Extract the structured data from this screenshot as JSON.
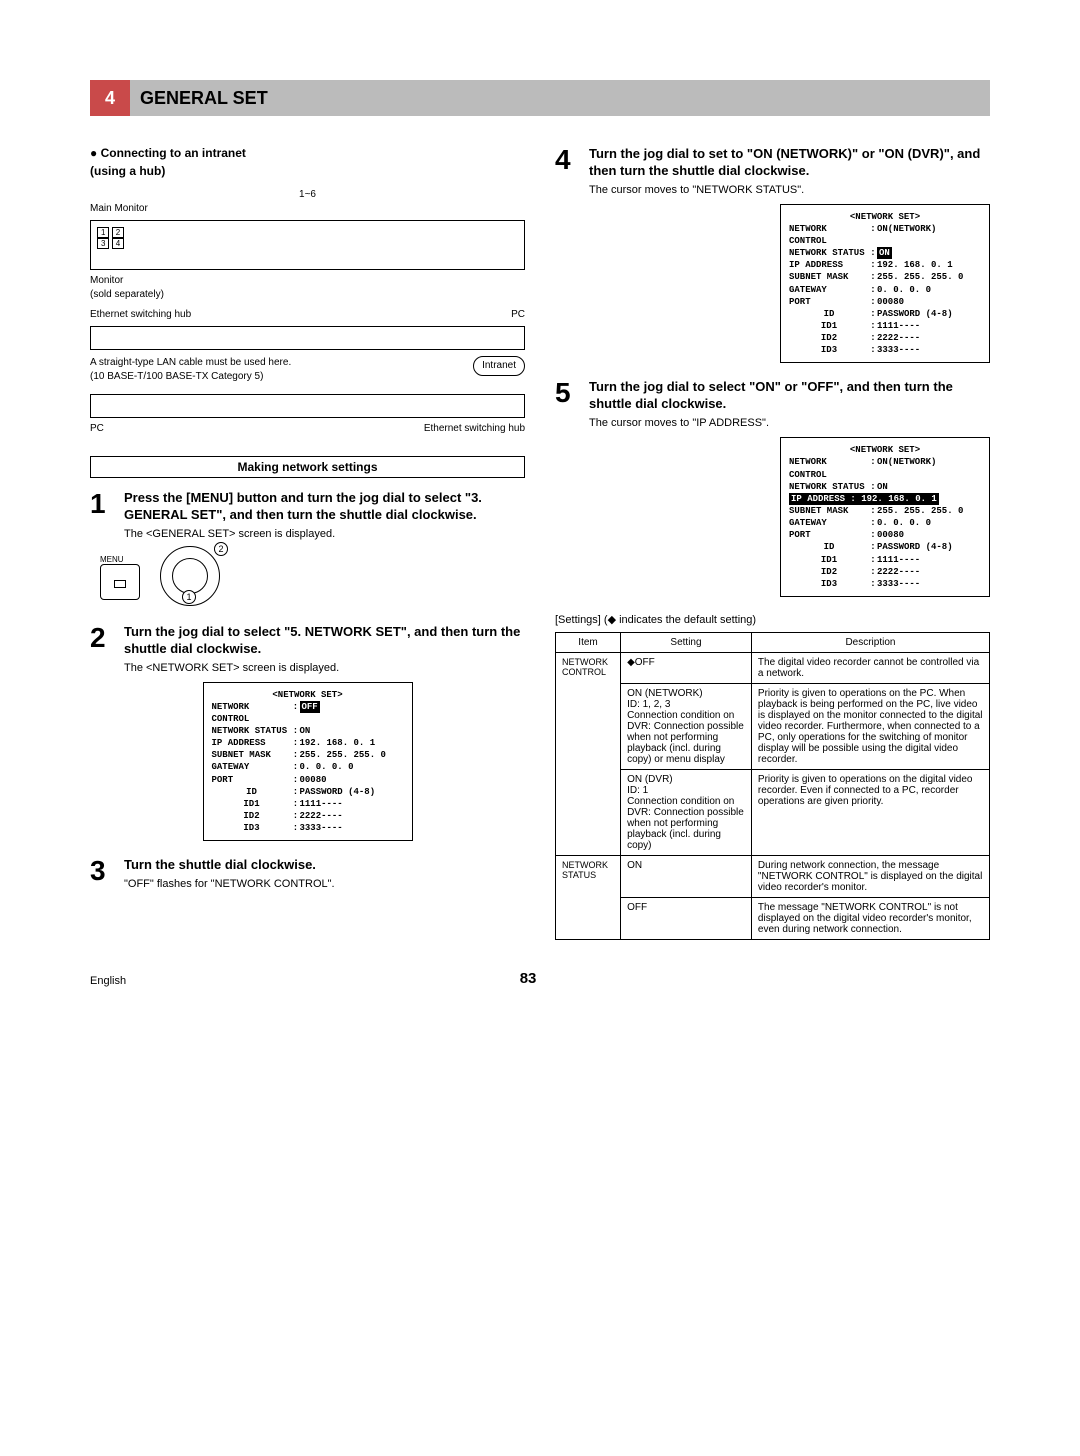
{
  "header": {
    "num": "4",
    "title": "GENERAL SET"
  },
  "left": {
    "connect_head": "● Connecting to an intranet",
    "connect_sub": "(using a hub)",
    "diag": {
      "range": "1~6",
      "main_monitor": "Main Monitor",
      "monitor": "Monitor",
      "sold_sep": "(sold separately)",
      "hub1": "Ethernet switching hub",
      "pc1": "PC",
      "cable_note1": "A straight-type LAN cable must be used here.",
      "cable_note2": "(10 BASE-T/100 BASE-TX Category 5)",
      "intranet": "Intranet",
      "pc2": "PC",
      "hub2": "Ethernet switching hub"
    },
    "making_settings": "Making network settings",
    "step1": {
      "num": "1",
      "title": "Press the [MENU] button and turn the jog dial to select \"3. GENERAL SET\", and then turn the shuttle dial clockwise.",
      "desc": "The <GENERAL SET> screen is displayed.",
      "menu": "MENU",
      "c1": "1",
      "c2": "2"
    },
    "step2": {
      "num": "2",
      "title": "Turn the jog dial to select \"5. NETWORK SET\", and then turn the shuttle dial clockwise.",
      "desc": "The <NETWORK SET> screen is displayed."
    },
    "osd2": {
      "title": "<NETWORK SET>",
      "ctrl_k": "NETWORK CONTROL",
      "ctrl_v": "OFF",
      "status_k": "NETWORK STATUS",
      "status_v": "ON",
      "ip_k": "IP ADDRESS",
      "ip_v": "192. 168.   0.   1",
      "subnet_k": "SUBNET MASK",
      "subnet_v": "255. 255. 255.   0",
      "gw_k": "GATEWAY",
      "gw_v": "  0.   0.   0.   0",
      "port_k": "PORT",
      "port_v": "00080",
      "id_k": "ID",
      "id_v": "PASSWORD (4-8)",
      "id1_k": "ID1",
      "id1_v": "1111----",
      "id2_k": "ID2",
      "id2_v": "2222----",
      "id3_k": "ID3",
      "id3_v": "3333----"
    },
    "step3": {
      "num": "3",
      "title": "Turn the shuttle dial clockwise.",
      "desc": "\"OFF\" flashes for \"NETWORK CONTROL\"."
    }
  },
  "right": {
    "step4": {
      "num": "4",
      "title": "Turn the jog dial to set to \"ON (NETWORK)\" or \"ON (DVR)\", and then turn the shuttle dial clockwise.",
      "desc": "The cursor moves to \"NETWORK STATUS\"."
    },
    "osd4": {
      "title": "<NETWORK SET>",
      "ctrl_k": "NETWORK CONTROL",
      "ctrl_v": "ON(NETWORK)",
      "status_k": "NETWORK STATUS",
      "status_v": "ON",
      "ip_k": "IP ADDRESS",
      "ip_v": "192. 168.   0.   1",
      "subnet_k": "SUBNET MASK",
      "subnet_v": "255. 255. 255.   0",
      "gw_k": "GATEWAY",
      "gw_v": "  0.   0.   0.   0",
      "port_k": "PORT",
      "port_v": "00080",
      "id_k": "ID",
      "id_v": "PASSWORD (4-8)",
      "id1_k": "ID1",
      "id1_v": "1111----",
      "id2_k": "ID2",
      "id2_v": "2222----",
      "id3_k": "ID3",
      "id3_v": "3333----"
    },
    "step5": {
      "num": "5",
      "title": "Turn the jog dial to select \"ON\" or \"OFF\", and then turn the shuttle dial clockwise.",
      "desc": "The cursor moves to \"IP ADDRESS\"."
    },
    "osd5": {
      "title": "<NETWORK SET>",
      "ctrl_k": "NETWORK CONTROL",
      "ctrl_v": "ON(NETWORK)",
      "status_k": "NETWORK STATUS",
      "status_v": "ON",
      "ip_k": "IP ADDRESS",
      "ip_v": "192. 168.   0.   1",
      "subnet_k": "SUBNET MASK",
      "subnet_v": "255. 255. 255.   0",
      "gw_k": "GATEWAY",
      "gw_v": "  0.   0.   0.   0",
      "port_k": "PORT",
      "port_v": "00080",
      "id_k": "ID",
      "id_v": "PASSWORD (4-8)",
      "id1_k": "ID1",
      "id1_v": "1111----",
      "id2_k": "ID2",
      "id2_v": "2222----",
      "id3_k": "ID3",
      "id3_v": "3333----"
    },
    "settings_note": "[Settings] (◆ indicates the default setting)",
    "table": {
      "h1": "Item",
      "h2": "Setting",
      "h3": "Description",
      "r1_item": "NETWORK CONTROL",
      "r1a_set": "◆OFF",
      "r1a_desc": "The digital video recorder cannot be controlled via a network.",
      "r1b_set": "ON (NETWORK)\nID: 1, 2, 3\nConnection condition on DVR: Connection possible when not performing playback (incl. during copy) or menu display",
      "r1b_desc": "Priority is given to operations on the PC. When playback is being performed on the PC, live video is displayed on the monitor connected to the digital video recorder. Furthermore, when connected to a PC, only operations for the switching of monitor display will be possible using the digital video recorder.",
      "r1c_set": "ON (DVR)\nID: 1\nConnection condition on DVR: Connection possible when not performing playback (incl. during copy)",
      "r1c_desc": "Priority is given to operations on the digital video recorder. Even if connected to a PC, recorder operations are given priority.",
      "r2_item": "NETWORK STATUS",
      "r2a_set": "ON",
      "r2a_desc": "During network connection, the message \"NETWORK CONTROL\" is displayed on the digital video recorder's monitor.",
      "r2b_set": "OFF",
      "r2b_desc": "The message \"NETWORK CONTROL\" is not displayed on the digital video recorder's monitor, even during network connection."
    }
  },
  "footer": {
    "lang": "English",
    "page": "83"
  }
}
